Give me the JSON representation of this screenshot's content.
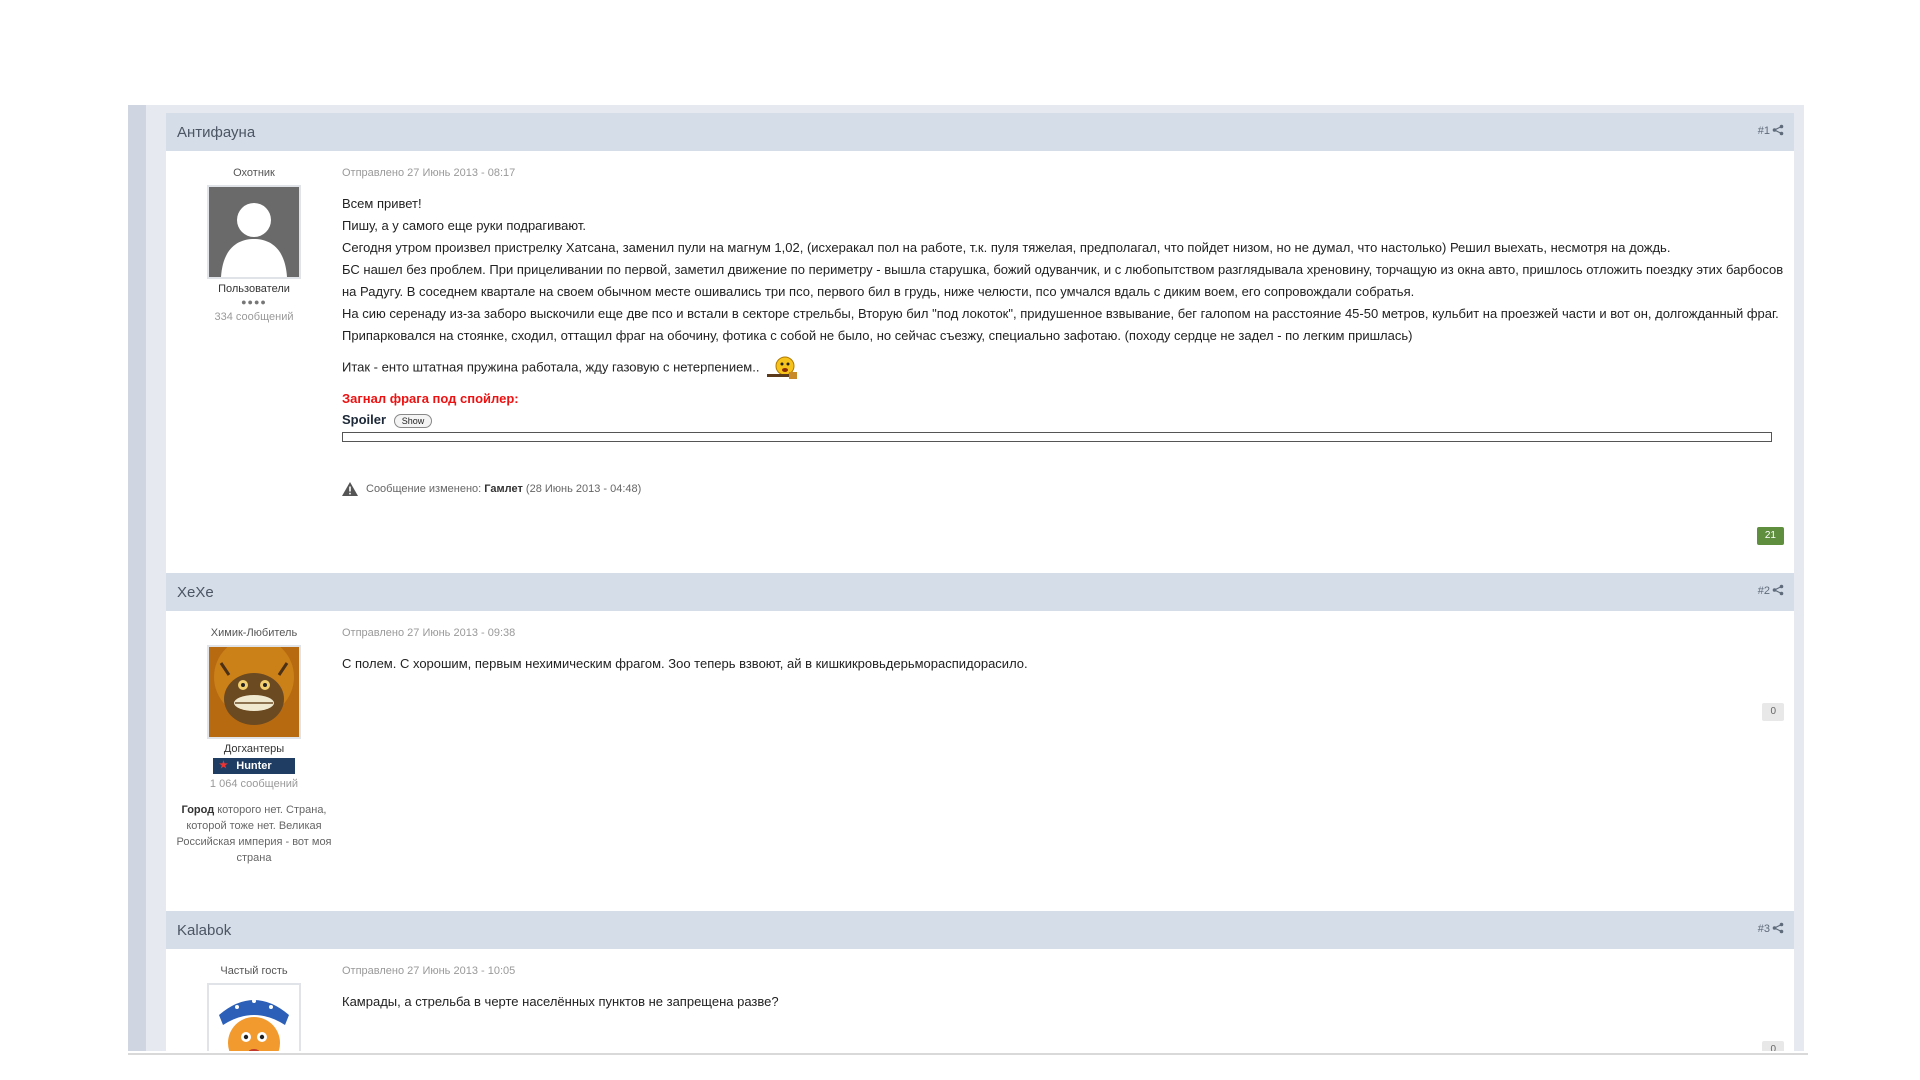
{
  "posts": [
    {
      "author": "Антифауна",
      "number": "#1",
      "title": "Охотник",
      "group": "Пользователи",
      "pips": "●●●●",
      "postcount": "334 сообщений",
      "date": "Отправлено 27 Июнь 2013 - 08:17",
      "lines": [
        "Всем привет!",
        "Пишу, а у самого еще руки подрагивают.",
        "Сегодня утром произвел пристрелку Хатсана, заменил пули на магнум 1,02, (исхеракал пол на работе, т.к. пуля тяжелая, предполагал, что пойдет низом, но не думал, что настолько)  Решил выехать, несмотря на дождь.",
        "БС нашел без проблем. При прицеливании по первой, заметил движение по периметру - вышла старушка, божий одуванчик, и с любопытством разглядывала хреновину, торчащую из окна авто, пришлось отложить поездку этих барбосов на Радугу. В соседнем квартале на своем обычном месте ошивались три псо, первого бил в грудь, ниже челюсти, псо умчался вдаль с диким воем, его сопровождали собратья.",
        "На сию серенаду из-за заборо выскочили еще две псо и встали в секторе стрельбы, Вторую бил \"под локоток\", придушенное взвывание, бег галопом на расстояние 45-50 метров, кульбит на проезжей части и вот он, долгожданный фраг.  Припарковался на стоянке, сходил, оттащил фраг на обочину, фотика с собой не было, но сейчас съезжу, специально зафотаю. (походу сердце не задел - по легким пришлась)"
      ],
      "last_line": "Итак - енто штатная пружина работала, жду газовую с нетерпением..",
      "spoiler_title": "Загнал фрага под спойлер:",
      "spoiler_label": "Spoiler",
      "show_label": "Show",
      "edit_prefix": "Сообщение изменено:",
      "edit_user": "Гамлет",
      "edit_date": "(28 Июнь 2013 - 04:48)",
      "rep": "21"
    },
    {
      "author": "ХеХе",
      "number": "#2",
      "title": "Химик-Любитель",
      "group": "Догхантеры",
      "badge": "Hunter",
      "postcount": "1 064 сообщений",
      "info_bold": "Город",
      "info_rest": " которого нет. Страна, которой тоже нет. Великая Российская империя - вот моя страна",
      "date": "Отправлено 27 Июнь 2013 - 09:38",
      "text": "С полем. С хорошим, первым нехимическим фрагом. Зоо теперь взвоют, ай в кишкикровьдерьмораспидорасило.",
      "rep": "0"
    },
    {
      "author": "Kalabok",
      "number": "#3",
      "title": "Частый гость",
      "date": "Отправлено 27 Июнь 2013 - 10:05",
      "text": "Камрады, а стрельба в черте населённых пунктов не запрещена разве?",
      "rep": "0"
    }
  ],
  "icons": [
    "share-icon",
    "warning-icon",
    "avatar-silhouette-icon",
    "smiley-icon"
  ]
}
